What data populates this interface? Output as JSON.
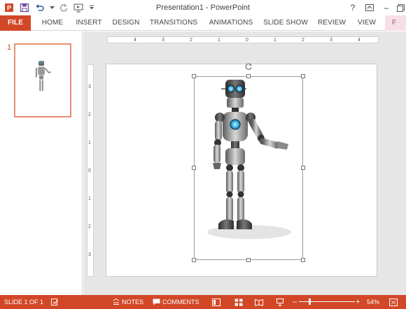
{
  "titlebar": {
    "title": "Presentation1 - PowerPoint",
    "controls": {
      "help": "?",
      "ribbon_options": "ribbon-display-options-icon",
      "minimize": "–",
      "restore": "restore-icon"
    }
  },
  "ribbon": {
    "tabs": [
      {
        "label": "FILE"
      },
      {
        "label": "HOME"
      },
      {
        "label": "INSERT"
      },
      {
        "label": "DESIGN"
      },
      {
        "label": "TRANSITIONS"
      },
      {
        "label": "ANIMATIONS"
      },
      {
        "label": "SLIDE SHOW"
      },
      {
        "label": "REVIEW"
      },
      {
        "label": "VIEW"
      },
      {
        "label": "F"
      }
    ]
  },
  "thumbnails": {
    "slide_number": "1"
  },
  "rulers": {
    "horizontal": [
      "4",
      "3",
      "2",
      "1",
      "0",
      "1",
      "2",
      "3",
      "4"
    ],
    "vertical": [
      "3",
      "2",
      "1",
      "0",
      "1",
      "2",
      "3"
    ]
  },
  "statusbar": {
    "slide_info": "SLIDE 1 OF 1",
    "notes": "NOTES",
    "comments": "COMMENTS",
    "zoom_minus": "–",
    "zoom_plus": "+",
    "zoom_level": "54%"
  },
  "colors": {
    "accent": "#d24726",
    "thumb_border": "#e7906f",
    "robot_eye": "#3ab4e6"
  }
}
